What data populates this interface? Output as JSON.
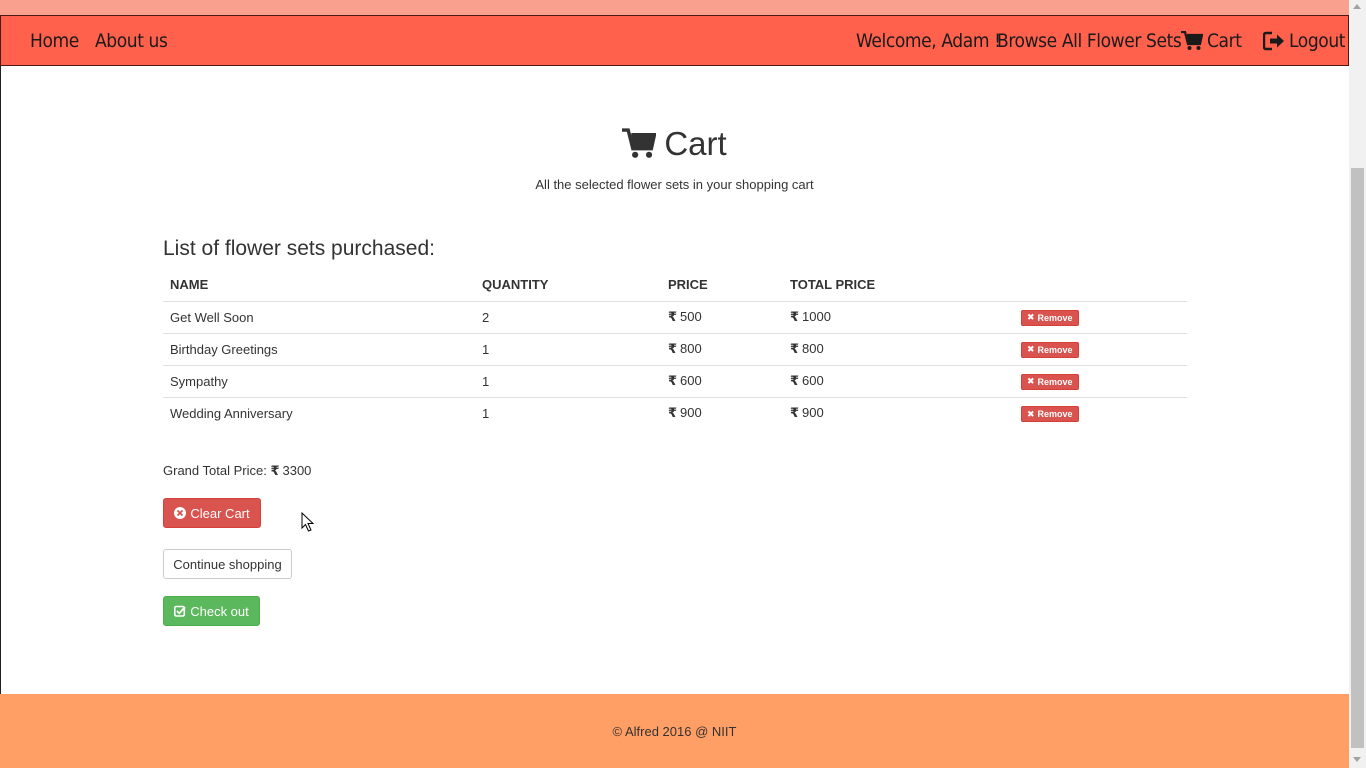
{
  "colors": {
    "nav_bg": "#ff614d",
    "top_strip": "#f9a08f",
    "footer_bg": "#ff9f66",
    "danger": "#d9534f",
    "success": "#5cb85c"
  },
  "nav": {
    "home": "Home",
    "about": "About us",
    "welcome": "Welcome, Adam !",
    "browse": "Browse All Flower Sets",
    "cart": "Cart",
    "logout": "Logout",
    "cart_icon": "shopping-cart-icon",
    "logout_icon": "sign-out-icon"
  },
  "header": {
    "title": "Cart",
    "title_icon": "shopping-cart-icon",
    "subtitle": "All the selected flower sets in your shopping cart"
  },
  "list_heading": "List of flower sets purchased:",
  "table": {
    "columns": [
      "NAME",
      "QUANTITY",
      "PRICE",
      "TOTAL PRICE"
    ],
    "currency": "₹",
    "remove_label": "Remove",
    "rows": [
      {
        "name": "Get Well Soon",
        "quantity": "2",
        "price": "500",
        "total": "1000"
      },
      {
        "name": "Birthday Greetings",
        "quantity": "1",
        "price": "800",
        "total": "800"
      },
      {
        "name": "Sympathy",
        "quantity": "1",
        "price": "600",
        "total": "600"
      },
      {
        "name": "Wedding Anniversary",
        "quantity": "1",
        "price": "900",
        "total": "900"
      }
    ]
  },
  "grand_total": {
    "label": "Grand Total Price:",
    "currency": "₹",
    "value": "3300"
  },
  "buttons": {
    "clear_cart": "Clear Cart",
    "continue_shopping": "Continue shopping",
    "check_out": "Check out"
  },
  "footer": {
    "text": "© Alfred 2016 @ NIIT"
  }
}
